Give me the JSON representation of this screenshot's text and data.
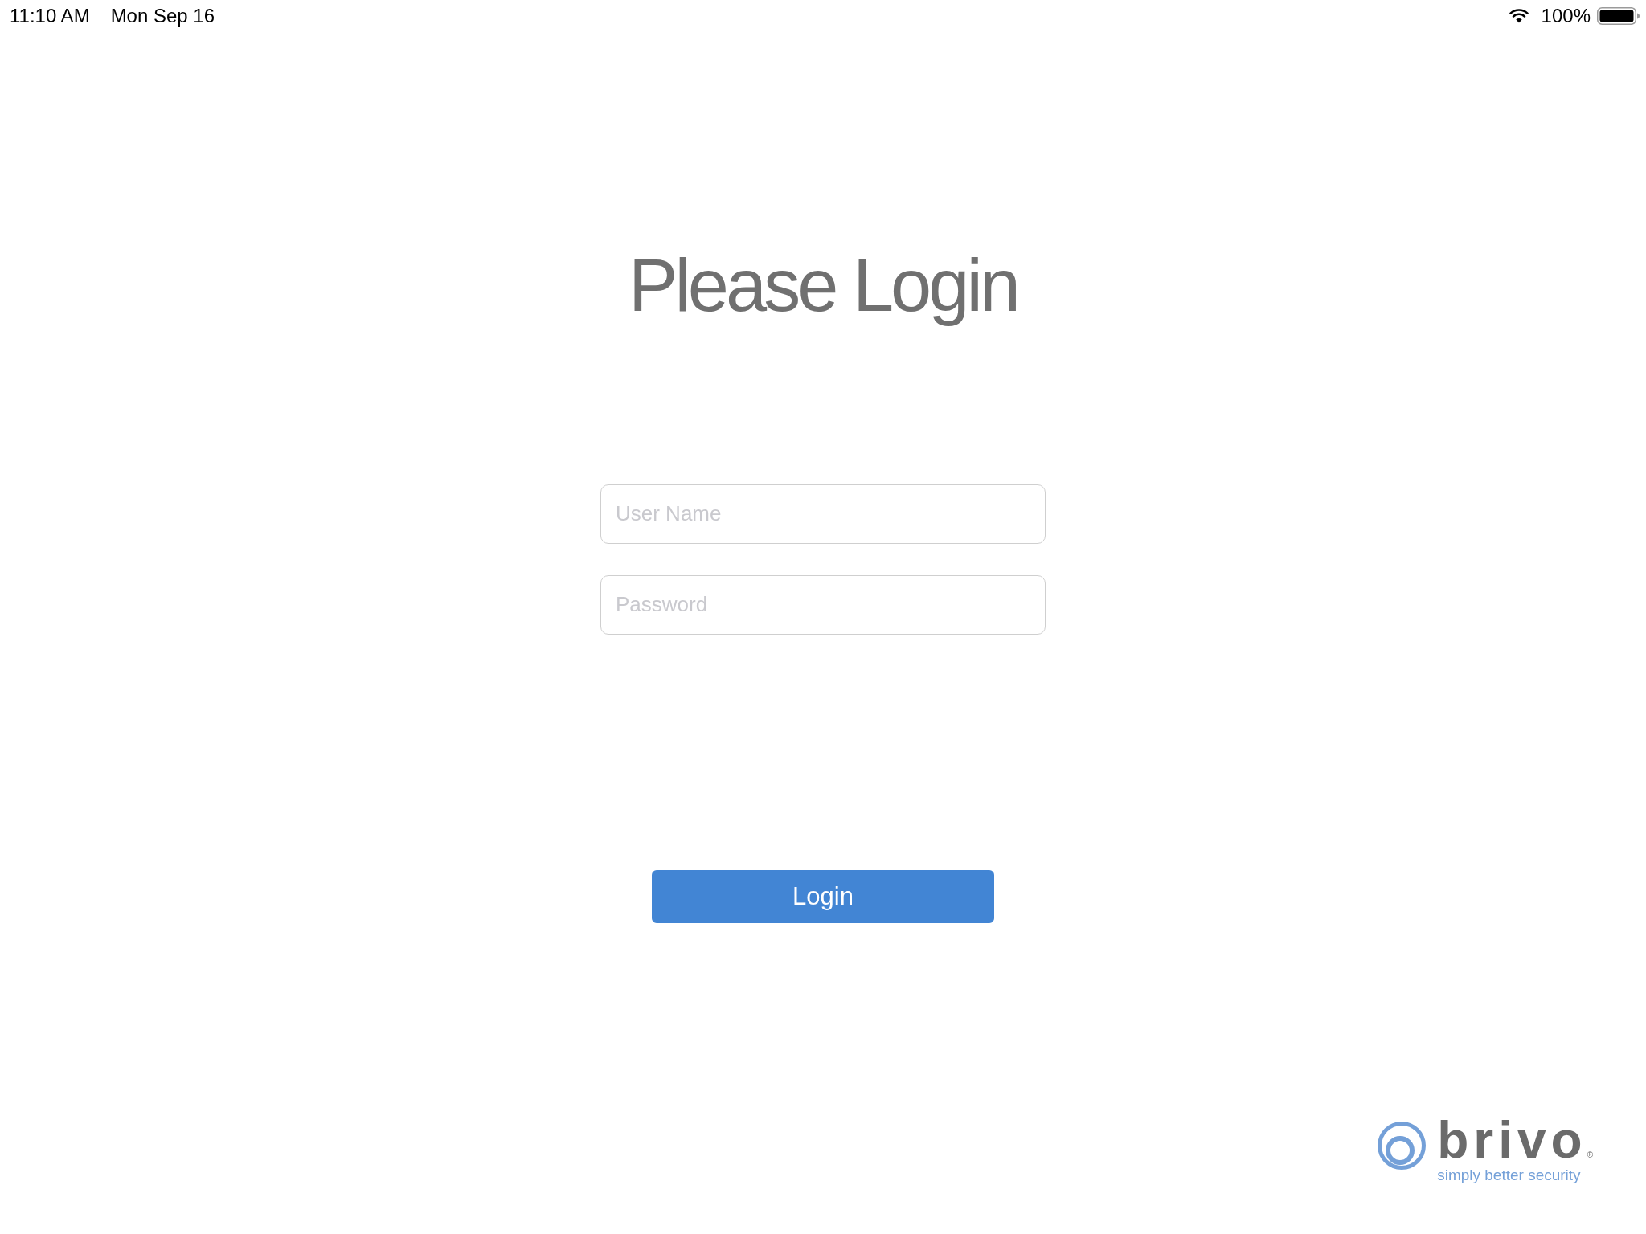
{
  "status_bar": {
    "time": "11:10 AM",
    "date": "Mon Sep 16",
    "battery": "100%"
  },
  "title": "Please Login",
  "fields": [
    {
      "placeholder": "User Name"
    },
    {
      "placeholder": "Password"
    }
  ],
  "login_button": {
    "label": "Login"
  },
  "logo": {
    "wordmark": "brivo",
    "registered": "®",
    "tagline": "simply better security"
  }
}
